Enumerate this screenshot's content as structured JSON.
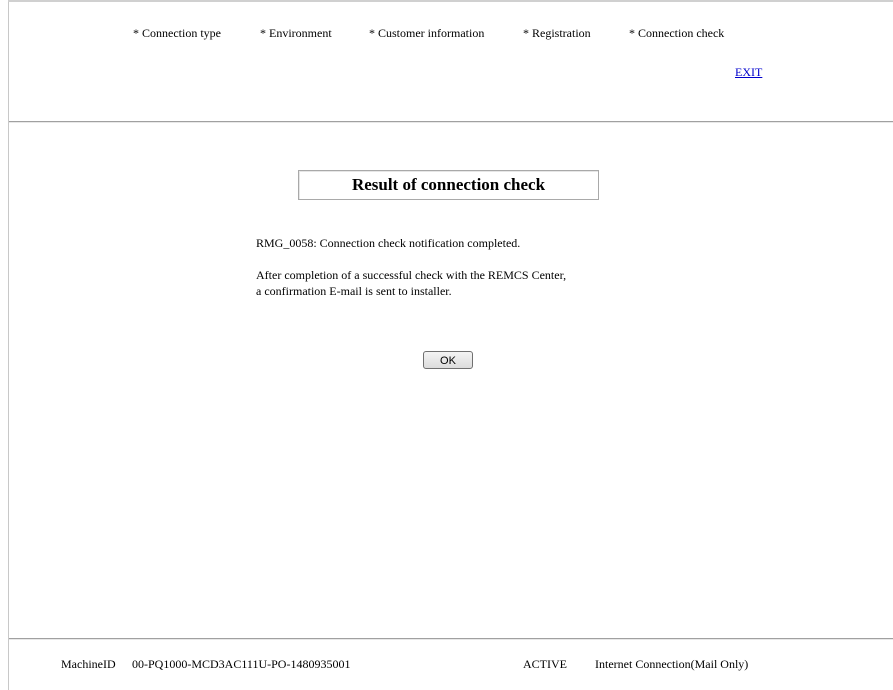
{
  "header": {
    "steps": [
      "* Connection type",
      "* Environment",
      "* Customer information",
      "* Registration",
      "* Connection check"
    ],
    "exit_label": "EXIT"
  },
  "main": {
    "title": "Result of connection check",
    "message": "RMG_0058: Connection check notification completed.",
    "info_line1": "After completion of a successful check with the REMCS Center,",
    "info_line2": "a confirmation E-mail is sent to installer.",
    "ok_label": "OK"
  },
  "footer": {
    "machine_id_label": "MachineID",
    "machine_id_value": "00-PQ1000-MCD3AC111U-PO-1480935001",
    "status": "ACTIVE",
    "connection": "Internet Connection(Mail Only)"
  }
}
